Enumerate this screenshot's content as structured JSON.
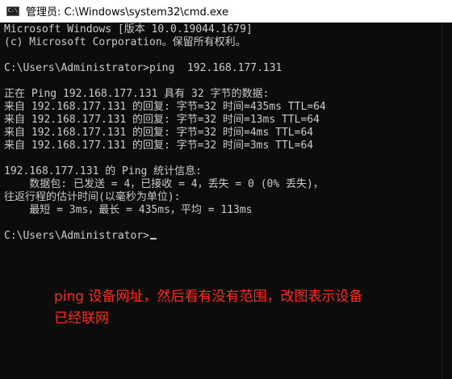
{
  "titlebar": {
    "icon_label": "C:\\",
    "title": "管理员: C:\\Windows\\system32\\cmd.exe"
  },
  "console": {
    "lines": [
      "Microsoft Windows [版本 10.0.19044.1679]",
      "(c) Microsoft Corporation。保留所有权利。",
      "",
      "C:\\Users\\Administrator>ping  192.168.177.131",
      "",
      "正在 Ping 192.168.177.131 具有 32 字节的数据:",
      "来自 192.168.177.131 的回复: 字节=32 时间=435ms TTL=64",
      "来自 192.168.177.131 的回复: 字节=32 时间=13ms TTL=64",
      "来自 192.168.177.131 的回复: 字节=32 时间=4ms TTL=64",
      "来自 192.168.177.131 的回复: 字节=32 时间=3ms TTL=64",
      "",
      "192.168.177.131 的 Ping 统计信息:",
      "    数据包: 已发送 = 4，已接收 = 4，丢失 = 0 (0% 丢失)，",
      "往返行程的估计时间(以毫秒为单位):",
      "    最短 = 3ms，最长 = 435ms，平均 = 113ms",
      "",
      "C:\\Users\\Administrator>"
    ]
  },
  "annotation": {
    "line1": "ping 设备网址，然后看有没有范围，改图表示设备",
    "line2": "已经联网"
  },
  "colors": {
    "console_bg": "#0c0c0c",
    "console_text": "#cccccc",
    "annotation": "#ff2a1f"
  }
}
